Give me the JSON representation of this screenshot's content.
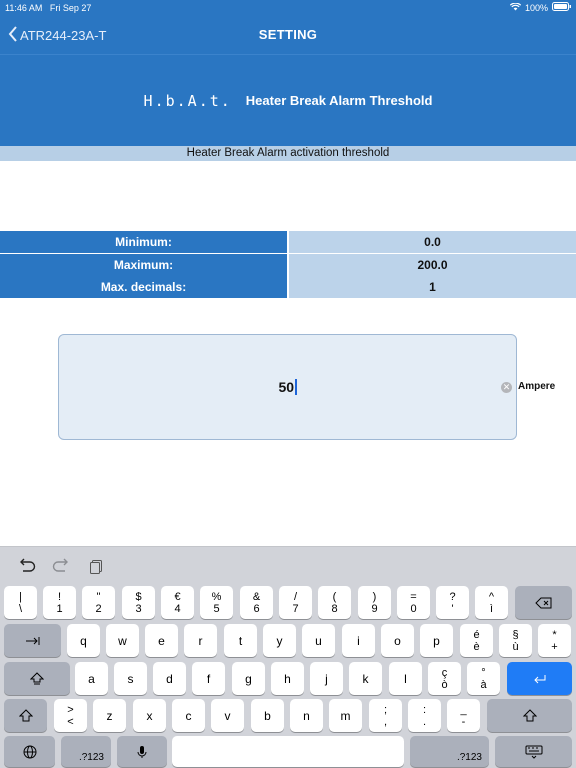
{
  "status": {
    "time": "11:46 AM",
    "date": "Fri Sep 27",
    "battery": "100%"
  },
  "nav": {
    "back_label": "ATR244-23A-T",
    "title": "SETTING"
  },
  "header": {
    "code": "H.b.A.t.",
    "title": "Heater Break Alarm Threshold"
  },
  "subtitle": "Heater Break Alarm activation threshold",
  "limits": [
    {
      "label": "Minimum:",
      "value": "0.0"
    },
    {
      "label": "Maximum:",
      "value": "200.0"
    },
    {
      "label": "Max. decimals:",
      "value": "1"
    }
  ],
  "input": {
    "value": "50",
    "unit": "Ampere"
  },
  "keyboard": {
    "number_row": [
      [
        "|",
        "\\"
      ],
      [
        "!",
        "1"
      ],
      [
        "\"",
        "2"
      ],
      [
        "$",
        "3"
      ],
      [
        "€",
        "4"
      ],
      [
        "%",
        "5"
      ],
      [
        "&",
        "6"
      ],
      [
        "/",
        "7"
      ],
      [
        "(",
        "8"
      ],
      [
        ")",
        "9"
      ],
      [
        "=",
        "0"
      ],
      [
        "?",
        "'"
      ],
      [
        "^",
        "ì"
      ]
    ],
    "row1": [
      "q",
      "w",
      "e",
      "r",
      "t",
      "y",
      "u",
      "i",
      "o",
      "p"
    ],
    "row1_extra": [
      [
        "é",
        "è"
      ],
      [
        "§",
        "ù"
      ],
      [
        "*",
        "+"
      ]
    ],
    "row2": [
      "a",
      "s",
      "d",
      "f",
      "g",
      "h",
      "j",
      "k",
      "l"
    ],
    "row2_extra": [
      [
        "ç",
        "ò"
      ],
      [
        "°",
        "à"
      ]
    ],
    "row3_first": [
      ">",
      "<"
    ],
    "row3": [
      "z",
      "x",
      "c",
      "v",
      "b",
      "n",
      "m"
    ],
    "row3_extra": [
      [
        ";",
        ","
      ],
      [
        ":",
        "."
      ],
      [
        "_",
        "-"
      ]
    ],
    "numbers_label": ".?123"
  },
  "colors": {
    "accent": "#2a76c2",
    "light": "#bcd3ea",
    "return": "#1f7cf6"
  }
}
